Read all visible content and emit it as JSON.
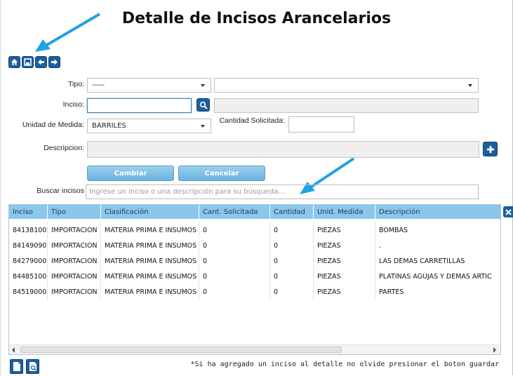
{
  "title": "Detalle de Incisos Arancelarios",
  "toolbar": {
    "icons": [
      "home-icon",
      "save-icon",
      "back-arrow-icon",
      "forward-arrow-icon"
    ]
  },
  "form": {
    "tipo_label": "Tipo:",
    "tipo_value": "-----",
    "tipo2_value": "",
    "inciso_label": "Inciso:",
    "inciso_value": "",
    "inciso2_value": "",
    "unidad_label": "Unidad de Medida:",
    "unidad_value": "BARRILES",
    "cantidad_label": "Cantidad Solicitada:",
    "cantidad_value": "",
    "descripcion_label": "Descripcion:",
    "descripcion_value": ""
  },
  "actions": {
    "cambiar": "Cambiar",
    "cancelar": "Cancelar"
  },
  "search": {
    "label": "Buscar incisos",
    "placeholder": "Ingrese un inciso o una descripción para su búsqueda..."
  },
  "table": {
    "headers": [
      "Inciso",
      "Tipo",
      "Clasificación",
      "Cant. Solicitada",
      "Cantidad",
      "Unid. Medida",
      "Descripción"
    ],
    "rows": [
      [
        "84138100",
        "IMPORTACION",
        "MATERIA PRIMA E INSUMOS",
        "0",
        "0",
        "PIEZAS",
        "BOMBAS"
      ],
      [
        "84149090",
        "IMPORTACION",
        "MATERIA PRIMA E INSUMOS",
        "0",
        "0",
        "PIEZAS",
        "."
      ],
      [
        "84279000",
        "IMPORTACION",
        "MATERIA PRIMA E INSUMOS",
        "0",
        "0",
        "PIEZAS",
        "LAS DEMAS CARRETILLAS"
      ],
      [
        "84485100",
        "IMPORTACION",
        "MATERIA PRIMA E INSUMOS",
        "0",
        "0",
        "PIEZAS",
        "PLATINAS  AGUJAS Y DEMAS ARTIC"
      ],
      [
        "84519000",
        "IMPORTACION",
        "MATERIA PRIMA E INSUMOS",
        "0",
        "0",
        "PIEZAS",
        "PARTES"
      ]
    ]
  },
  "footer": {
    "note": "*Si ha agregado un inciso al detalle no olvide presionar el boton guardar"
  },
  "colors": {
    "accent": "#1b5f9e",
    "header_bg": "#8cc6ea",
    "arrow": "#1fa3e0"
  }
}
